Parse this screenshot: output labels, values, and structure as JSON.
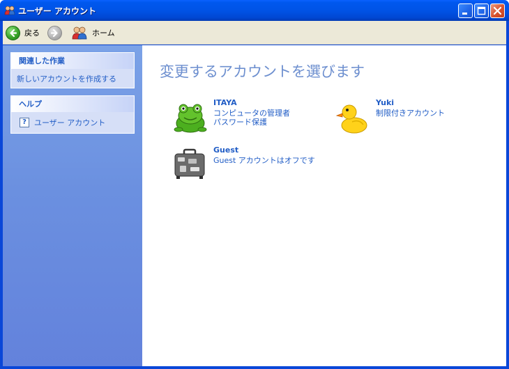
{
  "window": {
    "title": "ユーザー アカウント",
    "title_icon": "user-accounts-icon"
  },
  "toolbar": {
    "back_label": "戻る",
    "home_label": "ホーム"
  },
  "sidebar": {
    "related_tasks": {
      "heading": "関連した作業",
      "items": [
        {
          "label": "新しいアカウントを作成する"
        }
      ]
    },
    "help": {
      "heading": "ヘルプ",
      "items": [
        {
          "label": "ユーザー アカウント",
          "icon": "help-icon"
        }
      ]
    }
  },
  "main": {
    "title": "変更するアカウントを選びます",
    "accounts": [
      {
        "name": "ITAYA",
        "lines": [
          "コンピュータの管理者",
          "パスワード保護"
        ],
        "picture": "frog"
      },
      {
        "name": "Yuki",
        "lines": [
          "制限付きアカウント"
        ],
        "picture": "duck"
      },
      {
        "name": "Guest",
        "lines": [
          "Guest アカウントはオフです"
        ],
        "picture": "suitcase"
      }
    ]
  },
  "colors": {
    "title_bar": "#0053e6",
    "sidebar": "#6b90e0",
    "link": "#215dc6",
    "page_title": "#6d8fcf"
  }
}
